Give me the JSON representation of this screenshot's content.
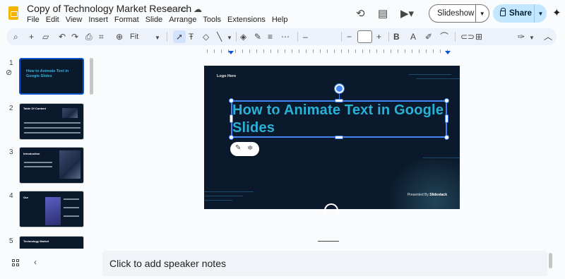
{
  "app": {
    "doc_title": "Copy of Technology Market Research",
    "menu": [
      "File",
      "Edit",
      "View",
      "Insert",
      "Format",
      "Slide",
      "Arrange",
      "Tools",
      "Extensions",
      "Help"
    ],
    "slideshow_label": "Slideshow",
    "share_label": "Share"
  },
  "toolbar": {
    "zoom_label": "Fit",
    "zoom_value": "Fit"
  },
  "slides": [
    {
      "num": "1",
      "title": "How to Animate Text in Google Slides"
    },
    {
      "num": "2",
      "title": "Table Of Content"
    },
    {
      "num": "3",
      "title": "Introduction"
    },
    {
      "num": "4",
      "title": "Our"
    },
    {
      "num": "5",
      "title": "Technology Market"
    }
  ],
  "canvas": {
    "logo_here": "Logo Here",
    "title": "How to Animate Text in Google Slides",
    "presented_by": "Presented By",
    "presenter": "Slidestack"
  },
  "notes": {
    "placeholder": "Click to add speaker notes"
  },
  "colors": {
    "accent": "#0b57d0",
    "slide_bg": "#0a1a2c",
    "title_color": "#29b1d6",
    "share_bg": "#c2e7ff"
  },
  "icons": [
    "star-icon",
    "move-folder-icon",
    "cloud-icon",
    "history-icon",
    "comment-icon",
    "meet-icon",
    "gemini-icon",
    "search-icon",
    "add-icon",
    "undo-icon",
    "redo-icon",
    "print-icon",
    "paint-format-icon",
    "zoom-icon",
    "select-icon",
    "textbox-icon",
    "image-icon",
    "shape-icon",
    "line-icon",
    "fill-color-icon",
    "border-color-icon",
    "border-weight-icon",
    "border-dash-icon",
    "decrease-font-icon",
    "increase-font-icon",
    "bold-icon",
    "text-color-icon",
    "highlight-icon",
    "link-icon",
    "insert-comment-icon",
    "more-icon",
    "pen-icon",
    "collapse-toolbar-icon"
  ]
}
